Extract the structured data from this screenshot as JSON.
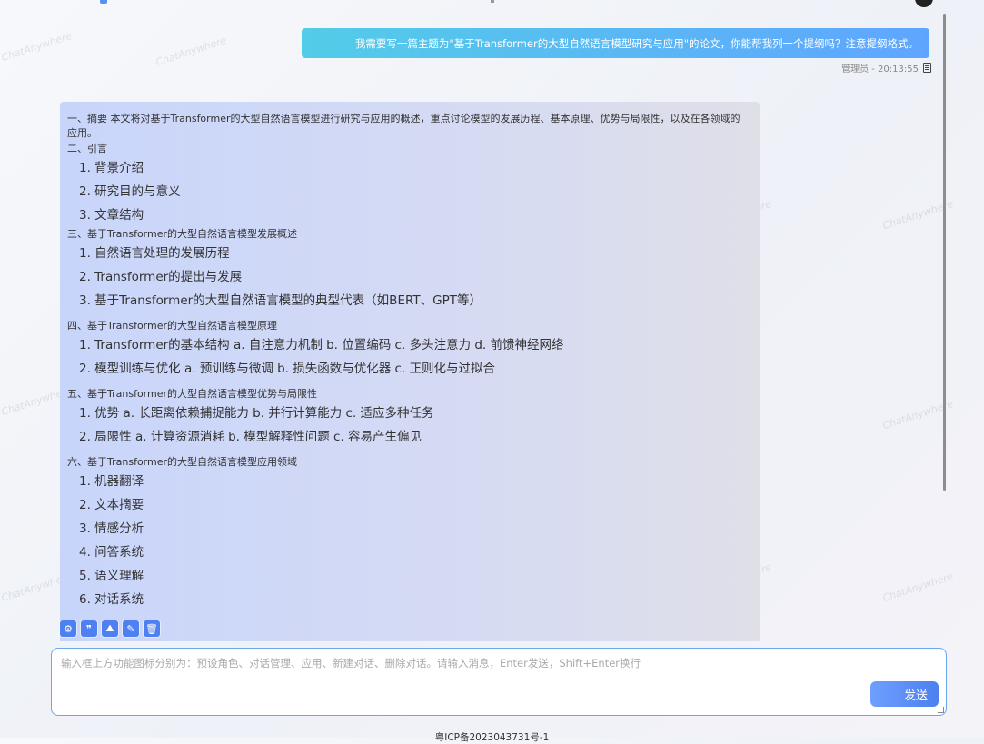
{
  "watermark_text": "ChatAnywhere",
  "user_message": {
    "text": "我需要写一篇主题为\"基于Transformer的大型自然语言模型研究与应用\"的论文，你能帮我列一个提纲吗？注意提纲格式。",
    "meta": "管理员 - 20:13:55",
    "copy_icon": "copy-icon"
  },
  "assistant_message": {
    "summary": "一、摘要 本文将对基于Transformer的大型自然语言模型进行研究与应用的概述，重点讨论模型的发展历程、基本原理、优势与局限性，以及在各领域的应用。",
    "sections": [
      {
        "title": "二、引言",
        "items": [
          "1. 背景介绍",
          "2. 研究目的与意义",
          "3. 文章结构"
        ]
      },
      {
        "title": "三、基于Transformer的大型自然语言模型发展概述",
        "items": [
          "1. 自然语言处理的发展历程",
          "2. Transformer的提出与发展",
          "3. 基于Transformer的大型自然语言模型的典型代表（如BERT、GPT等）"
        ]
      },
      {
        "title": "四、基于Transformer的大型自然语言模型原理",
        "items": [
          "1. Transformer的基本结构 a. 自注意力机制 b. 位置编码 c. 多头注意力 d. 前馈神经网络",
          "2. 模型训练与优化 a. 预训练与微调 b. 损失函数与优化器 c. 正则化与过拟合"
        ]
      },
      {
        "title": "五、基于Transformer的大型自然语言模型优势与局限性",
        "items": [
          "1. 优势 a. 长距离依赖捕捉能力 b. 并行计算能力 c. 适应多种任务",
          "2. 局限性 a. 计算资源消耗 b. 模型解释性问题 c. 容易产生偏见"
        ]
      },
      {
        "title": "六、基于Transformer的大型自然语言模型应用领域",
        "items": [
          "1. 机器翻译",
          "2. 文本摘要",
          "3. 情感分析",
          "4. 问答系统",
          "5. 语义理解",
          "6. 对话系统"
        ]
      }
    ]
  },
  "toolbar": {
    "buttons": [
      {
        "name": "preset-role",
        "icon": "gear-icon",
        "glyph": "⚙"
      },
      {
        "name": "conversation-manage",
        "icon": "chat-bubbles-icon",
        "glyph": "❞"
      },
      {
        "name": "apps",
        "icon": "apps-icon",
        "glyph": "⛰"
      },
      {
        "name": "new-chat",
        "icon": "new-chat-icon",
        "glyph": "✎"
      },
      {
        "name": "delete-chat",
        "icon": "trash-icon",
        "glyph": "🗑"
      }
    ]
  },
  "input": {
    "placeholder": "输入框上方功能图标分别为：预设角色、对话管理、应用、新建对话、删除对话。请输入消息，Enter发送，Shift+Enter换行",
    "value": "",
    "send_label": "发送"
  },
  "footer": {
    "icp": "粤ICP备2023043731号-1"
  },
  "colors": {
    "user_bubble_start": "#53cce8",
    "user_bubble_end": "#5fa5ff",
    "assistant_bubble": "#c8d5fb",
    "accent": "#4f80f2",
    "input_border": "#6aa7ee"
  }
}
